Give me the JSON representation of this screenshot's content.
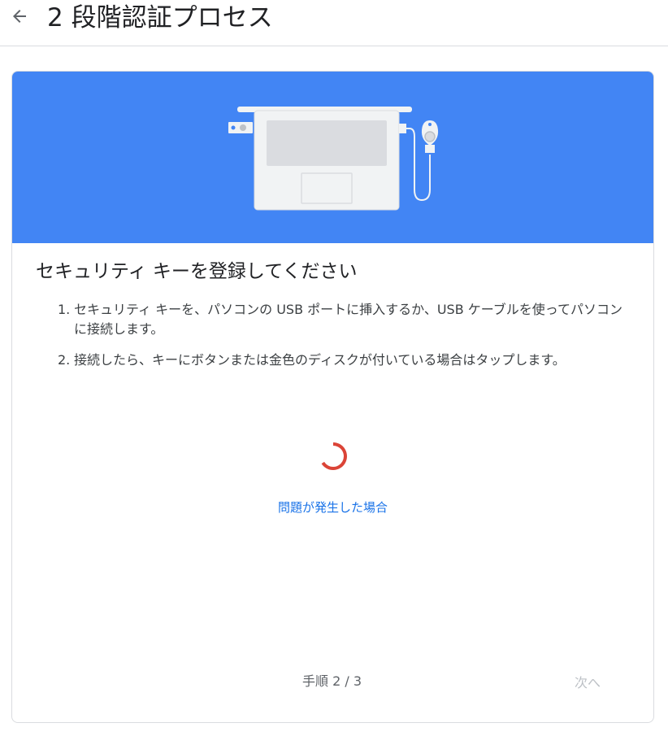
{
  "header": {
    "back_icon": "arrow-left-icon",
    "title": "2 段階認証プロセス"
  },
  "card": {
    "hero_colors": {
      "background": "#4285f4",
      "laptop": "#f1f3f4",
      "screen": "#dadce0"
    },
    "title": "セキュリティ キーを登録してください",
    "steps": [
      {
        "num": "1.",
        "text": "セキュリティ キーを、パソコンの USB ポートに挿入するか、USB ケーブルを使ってパソコンに接続します。"
      },
      {
        "num": "2.",
        "text": "接続したら、キーにボタンまたは金色のディスクが付いている場合はタップします。"
      }
    ],
    "spinner_color": "#db4437",
    "help_link": "問題が発生した場合",
    "step_counter": "手順 2 / 3",
    "next_label": "次へ"
  }
}
